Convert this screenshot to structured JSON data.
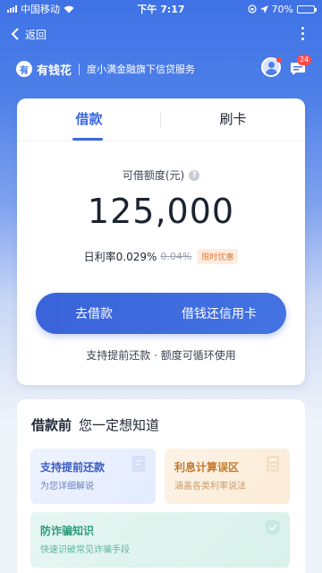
{
  "status_bar": {
    "carrier": "中国移动",
    "time": "下午 7:17",
    "battery": "70%",
    "battery_level": 0.7
  },
  "nav": {
    "back_label": "返回"
  },
  "brand": {
    "logo_char": "有",
    "name": "有钱花",
    "subtitle": "度小满金融旗下信贷服务",
    "message_count": "24"
  },
  "tabs": [
    {
      "label": "借款",
      "active": true
    },
    {
      "label": "刷卡",
      "active": false
    }
  ],
  "loan": {
    "limit_label": "可借额度(元)",
    "help_icon": "?",
    "amount": "125,000",
    "rate_label": "日利率0.029%",
    "old_rate": "0.04%",
    "promo_tag": "限时优惠",
    "borrow_button": "去借款",
    "repay_card_button": "借钱还信用卡",
    "note": "支持提前还款 · 额度可循环使用"
  },
  "info": {
    "title_bold": "借款前",
    "title_rest": "您一定想知道",
    "tiles": [
      {
        "title": "支持提前还款",
        "subtitle": "为您详细解说"
      },
      {
        "title": "利息计算误区",
        "subtitle": "涵盖各类利率说法"
      },
      {
        "title": "防诈骗知识",
        "subtitle": "快速识破常见诈骗手段"
      }
    ]
  },
  "colors": {
    "brand_blue": "#3f72e6",
    "primary": "#3a68df",
    "promo": "#e07b3c"
  }
}
